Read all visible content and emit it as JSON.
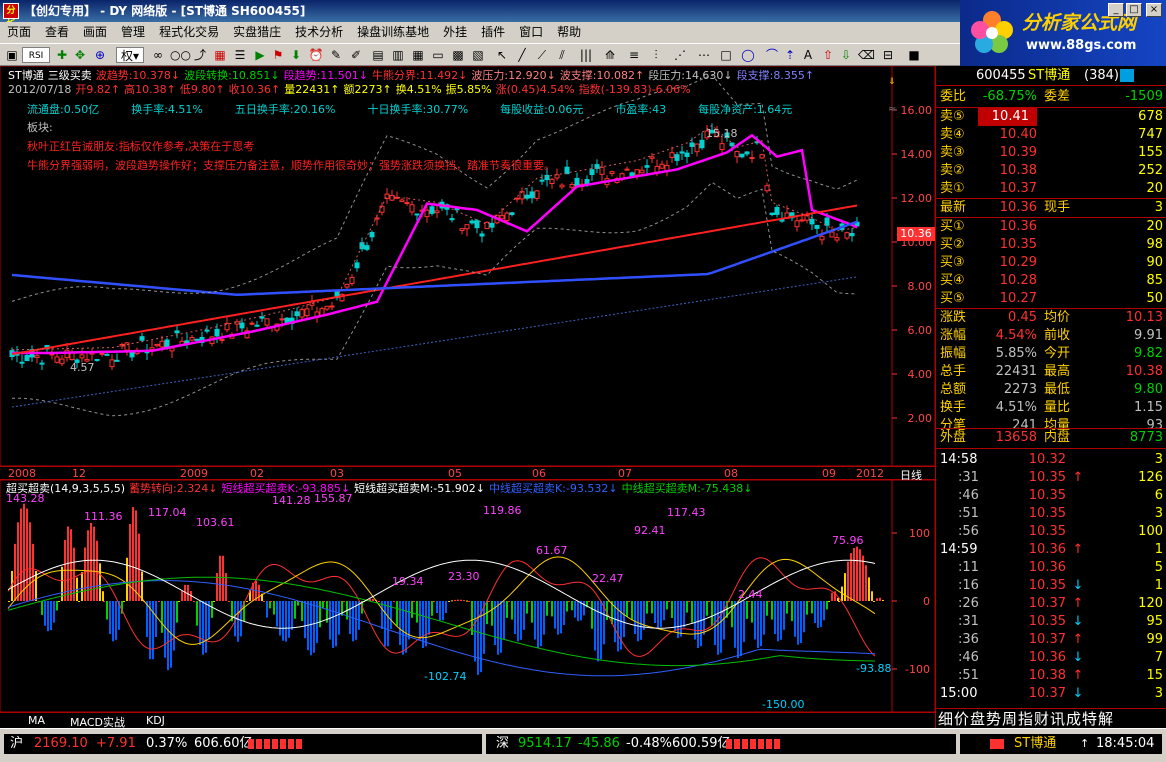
{
  "window": {
    "title": "【创幻专用】 - DY 网络版 - [ST博通 SH600455]",
    "icon_text": "分析",
    "min": "_",
    "max": "□",
    "close": "×"
  },
  "menu": [
    "页面",
    "查看",
    "画面",
    "管理",
    "程式化交易",
    "实盘猎庄",
    "技术分析",
    "操盘训练基地",
    "外挂",
    "插件",
    "窗口",
    "帮助"
  ],
  "toolbar": {
    "quan": "权"
  },
  "brand": {
    "name": "分析家公式网",
    "url": "www.88gs.com"
  },
  "main": {
    "line1": [
      {
        "t": "ST博通",
        "c": "#ffffff"
      },
      {
        "t": "三级买卖",
        "c": "#ffffff"
      },
      {
        "t": "波趋势:10.378↓",
        "c": "#ff3030"
      },
      {
        "t": "波段转换:10.851↓",
        "c": "#00d000"
      },
      {
        "t": "段趋势:11.501↓",
        "c": "#ff00ff"
      },
      {
        "t": "牛熊分界:11.492↓",
        "c": "#ff3030"
      },
      {
        "t": "波压力:12.920↓",
        "c": "#ff8080"
      },
      {
        "t": "波支撑:10.082↑",
        "c": "#ff8080"
      },
      {
        "t": "段压力:14.630↓",
        "c": "#c0c0c0"
      },
      {
        "t": "段支撑:8.355↑",
        "c": "#8080ff"
      }
    ],
    "line2": [
      {
        "t": "2012/07/18",
        "c": "#c0c0c0"
      },
      {
        "t": "开9.82↑",
        "c": "#ff3030"
      },
      {
        "t": "高10.38↑",
        "c": "#ff3030"
      },
      {
        "t": "低9.80↑",
        "c": "#ff3030"
      },
      {
        "t": "收10.36↑",
        "c": "#ff3030"
      },
      {
        "t": "量22431↑",
        "c": "#ffff00"
      },
      {
        "t": "额2273↑",
        "c": "#ffff00"
      },
      {
        "t": "换4.51%",
        "c": "#ffff00"
      },
      {
        "t": "振5.85%",
        "c": "#ffff00"
      },
      {
        "t": "涨(0.45)4.54%",
        "c": "#ff3030"
      },
      {
        "t": "指数(-139.83)-6.06%",
        "c": "#ff3030"
      }
    ],
    "line3": [
      {
        "t": "流通盘:0.50亿",
        "c": "#00d0d0"
      },
      {
        "t": "换手率:4.51%",
        "c": "#00d0d0"
      },
      {
        "t": "五日换手率:20.16%",
        "c": "#00d0d0"
      },
      {
        "t": "十日换手率:30.77%",
        "c": "#00d0d0"
      },
      {
        "t": "每股收益:0.06元",
        "c": "#00d0d0"
      },
      {
        "t": "市盈率:43",
        "c": "#00d0d0"
      },
      {
        "t": "每股净资产:1.64元",
        "c": "#00d0d0"
      }
    ],
    "bankuai": "板块:",
    "note1": "秋叶正红告诫朋友:指标仅作参考,决策在于思考",
    "note2": "牛熊分界强弱明，波段趋势操作好；支撑压力备注意，顺势作用很奇妙；强势涨跌须换挡，踏准节奏很重要。",
    "y_ticks": [
      "16.00",
      "14.00",
      "12.00",
      "10.00",
      "8.00",
      "6.00",
      "4.00",
      "2.00"
    ],
    "high_label": "15.18",
    "low_label": "4.57",
    "last_price": "10.36",
    "x_ticks": [
      "2008",
      "12",
      "2009",
      "02",
      "03",
      "05",
      "06",
      "07",
      "08",
      "09",
      "2012"
    ],
    "period": "日线"
  },
  "indicator": {
    "header": [
      {
        "t": "超买超卖(14,9,3,5,5,5)",
        "c": "#ffffff"
      },
      {
        "t": "蓄势转向:2.324↓",
        "c": "#ff3030"
      },
      {
        "t": "短线超买超卖K:-93.885↓",
        "c": "#ff00ff"
      },
      {
        "t": "短线超买超卖M:-51.902↓",
        "c": "#ffffff"
      },
      {
        "t": "中线超买超卖K:-93.532↓",
        "c": "#3060ff"
      },
      {
        "t": "中线超买超卖M:-75.438↓",
        "c": "#00d000"
      }
    ],
    "y_ticks": [
      "100",
      "0",
      "-100"
    ],
    "labels": [
      "143.28",
      "111.36",
      "117.04",
      "103.61",
      "141.28",
      "155.87",
      "19.34",
      "23.30",
      "119.86",
      "61.67",
      "22.47",
      "92.41",
      "117.43",
      "2.44",
      "75.96",
      "-102.74",
      "-150.00",
      "-93.88"
    ],
    "tabs": [
      "MA",
      "MACD实战",
      "KDJ"
    ]
  },
  "quote": {
    "code": "600455",
    "name": "ST博通",
    "num": "(384)",
    "weibi_label": "委比",
    "weibi": "-68.75%",
    "weicha_label": "委差",
    "weicha": "-1509",
    "sells": [
      {
        "label": "卖⑤",
        "price": "10.41",
        "vol": "678"
      },
      {
        "label": "卖④",
        "price": "10.40",
        "vol": "747"
      },
      {
        "label": "卖③",
        "price": "10.39",
        "vol": "155"
      },
      {
        "label": "卖②",
        "price": "10.38",
        "vol": "252"
      },
      {
        "label": "卖①",
        "price": "10.37",
        "vol": "20"
      }
    ],
    "latest_label": "最新",
    "latest": "10.36",
    "xianshou_label": "现手",
    "xianshou": "3",
    "buys": [
      {
        "label": "买①",
        "price": "10.36",
        "vol": "20"
      },
      {
        "label": "买②",
        "price": "10.35",
        "vol": "98"
      },
      {
        "label": "买③",
        "price": "10.29",
        "vol": "90"
      },
      {
        "label": "买④",
        "price": "10.28",
        "vol": "85"
      },
      {
        "label": "买⑤",
        "price": "10.27",
        "vol": "50"
      }
    ],
    "stats": [
      {
        "l1": "涨跌",
        "v1": "0.45",
        "c1": "#ff3030",
        "l2": "均价",
        "v2": "10.13",
        "c2": "#ff3030"
      },
      {
        "l1": "涨幅",
        "v1": "4.54%",
        "c1": "#ff3030",
        "l2": "前收",
        "v2": "9.91",
        "c2": "#c0c0c0"
      },
      {
        "l1": "振幅",
        "v1": "5.85%",
        "c1": "#c0c0c0",
        "l2": "今开",
        "v2": "9.82",
        "c2": "#00d000"
      },
      {
        "l1": "总手",
        "v1": "22431",
        "c1": "#c0c0c0",
        "l2": "最高",
        "v2": "10.38",
        "c2": "#ff3030"
      },
      {
        "l1": "总额",
        "v1": "2273",
        "c1": "#c0c0c0",
        "l2": "最低",
        "v2": "9.80",
        "c2": "#00d000"
      },
      {
        "l1": "换手",
        "v1": "4.51%",
        "c1": "#c0c0c0",
        "l2": "量比",
        "v2": "1.15",
        "c2": "#c0c0c0"
      },
      {
        "l1": "分笔",
        "v1": "241",
        "c1": "#c0c0c0",
        "l2": "均量",
        "v2": "93",
        "c2": "#c0c0c0"
      }
    ],
    "waipan_label": "外盘",
    "waipan": "13658",
    "neipan_label": "内盘",
    "neipan": "8773",
    "ticks": [
      {
        "t": "14:58",
        "p": "10.32",
        "a": "",
        "v": "3",
        "pc": "#ff3030",
        "ac": "",
        "bold": true
      },
      {
        "t": ":31",
        "p": "10.35",
        "a": "↑",
        "v": "126",
        "pc": "#ff3030",
        "ac": "#ff3030"
      },
      {
        "t": ":46",
        "p": "10.35",
        "a": "",
        "v": "6",
        "pc": "#ff3030",
        "ac": ""
      },
      {
        "t": ":51",
        "p": "10.35",
        "a": "",
        "v": "3",
        "pc": "#ff3030",
        "ac": ""
      },
      {
        "t": ":56",
        "p": "10.35",
        "a": "",
        "v": "100",
        "pc": "#ff3030",
        "ac": ""
      },
      {
        "t": "14:59",
        "p": "10.36",
        "a": "↑",
        "v": "1",
        "pc": "#ff3030",
        "ac": "#ff3030",
        "bold": true
      },
      {
        "t": ":11",
        "p": "10.36",
        "a": "",
        "v": "5",
        "pc": "#ff3030",
        "ac": ""
      },
      {
        "t": ":16",
        "p": "10.35",
        "a": "↓",
        "v": "1",
        "pc": "#ff3030",
        "ac": "#00d0ff"
      },
      {
        "t": ":26",
        "p": "10.37",
        "a": "↑",
        "v": "120",
        "pc": "#ff3030",
        "ac": "#ff3030"
      },
      {
        "t": ":31",
        "p": "10.35",
        "a": "↓",
        "v": "95",
        "pc": "#ff3030",
        "ac": "#00d0ff"
      },
      {
        "t": ":36",
        "p": "10.37",
        "a": "↑",
        "v": "99",
        "pc": "#ff3030",
        "ac": "#ff3030"
      },
      {
        "t": ":46",
        "p": "10.36",
        "a": "↓",
        "v": "7",
        "pc": "#ff3030",
        "ac": "#00d0ff"
      },
      {
        "t": ":51",
        "p": "10.38",
        "a": "↑",
        "v": "15",
        "pc": "#ff3030",
        "ac": "#ff3030"
      },
      {
        "t": "15:00",
        "p": "10.37",
        "a": "↓",
        "v": "3",
        "pc": "#ff3030",
        "ac": "#00d0ff",
        "bold": true
      }
    ],
    "tabs": "细价盘势周指财讯成特解"
  },
  "status": {
    "sh_label": "沪",
    "sh": "2169.10",
    "sh_chg": "+7.91",
    "sh_pct": "0.37%",
    "sh_amt": "606.60亿",
    "sz_label": "深",
    "sz": "9514.17",
    "sz_chg": "-45.86",
    "sz_pct": "-0.48%",
    "sz_amt": "600.59亿",
    "stock": "ST博通",
    "time": "18:45:04"
  }
}
